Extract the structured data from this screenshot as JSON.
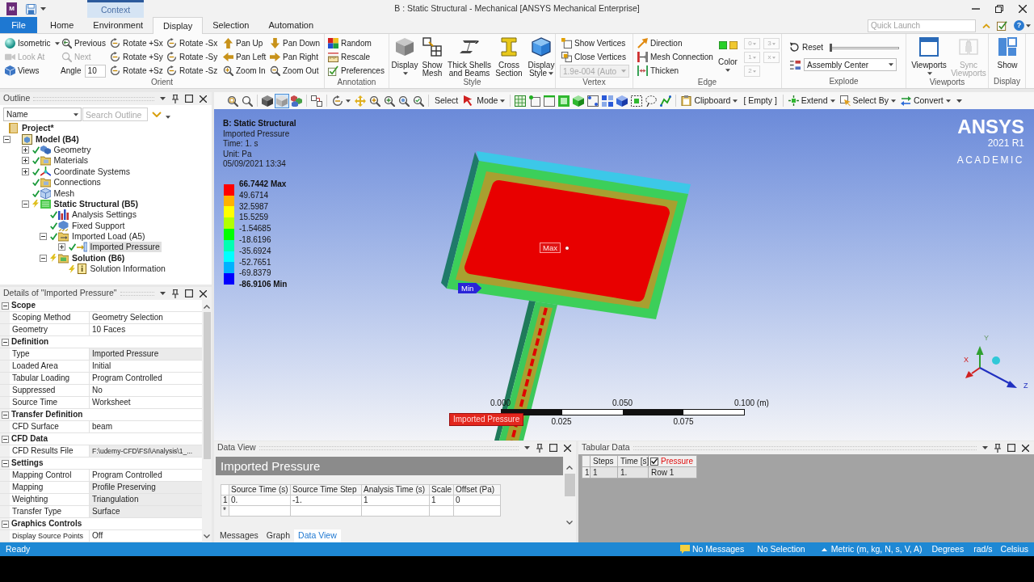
{
  "title_bar": {
    "app_logo": "M",
    "context_label": "Context",
    "title": "B : Static Structural - Mechanical [ANSYS Mechanical Enterprise]"
  },
  "ribbon_tabs": [
    {
      "label": "File",
      "kind": "file",
      "selected": false
    },
    {
      "label": "Home",
      "kind": "tab",
      "selected": false
    },
    {
      "label": "Environment",
      "kind": "tab",
      "selected": false
    },
    {
      "label": "Display",
      "kind": "tab",
      "selected": true
    },
    {
      "label": "Selection",
      "kind": "tab",
      "selected": false
    },
    {
      "label": "Automation",
      "kind": "tab",
      "selected": false
    }
  ],
  "quick_launch": {
    "placeholder": "Quick Launch",
    "help": "?"
  },
  "ribbon": {
    "orient": {
      "label": "Orient",
      "columns": [
        [
          {
            "kind": "split",
            "label": "Isometric",
            "disabled": false
          },
          {
            "kind": "button",
            "label": "Look At",
            "disabled": true
          },
          {
            "kind": "button",
            "label": "Views",
            "disabled": false
          }
        ],
        [
          {
            "kind": "button",
            "label": "Previous",
            "disabled": false
          },
          {
            "kind": "button",
            "label": "Next",
            "disabled": true
          },
          {
            "kind": "field",
            "label": "Angle",
            "value": "10"
          }
        ],
        [
          {
            "kind": "button",
            "label": "Rotate +Sx",
            "disabled": false
          },
          {
            "kind": "button",
            "label": "Rotate +Sy",
            "disabled": false
          },
          {
            "kind": "button",
            "label": "Rotate +Sz",
            "disabled": false
          }
        ],
        [
          {
            "kind": "button",
            "label": "Rotate -Sx",
            "disabled": false
          },
          {
            "kind": "button",
            "label": "Rotate -Sy",
            "disabled": false
          },
          {
            "kind": "button",
            "label": "Rotate -Sz",
            "disabled": false
          }
        ],
        [
          {
            "kind": "button",
            "label": "Pan Up",
            "disabled": false
          },
          {
            "kind": "button",
            "label": "Pan Left",
            "disabled": false
          },
          {
            "kind": "button",
            "label": "Zoom In",
            "disabled": false
          }
        ],
        [
          {
            "kind": "button",
            "label": "Pan Down",
            "disabled": false
          },
          {
            "kind": "button",
            "label": "Pan Right",
            "disabled": false
          },
          {
            "kind": "button",
            "label": "Zoom Out",
            "disabled": false
          }
        ]
      ]
    },
    "annotation": {
      "label": "Annotation",
      "buttons": [
        {
          "label": "Random"
        },
        {
          "label": "Rescale"
        },
        {
          "label": "Preferences"
        }
      ]
    },
    "style": {
      "label": "Style",
      "buttons": [
        {
          "label": "Display",
          "kind": "menu"
        },
        {
          "label": "Show Mesh",
          "kind": "button"
        },
        {
          "label": "Thick Shells and Beams",
          "kind": "button"
        },
        {
          "label": "Cross Section",
          "kind": "button"
        },
        {
          "label": "Display Style",
          "kind": "menu"
        }
      ]
    },
    "vertex": {
      "label": "Vertex",
      "buttons": [
        {
          "label": "Show Vertices"
        },
        {
          "label": "Close Vertices"
        }
      ],
      "size": {
        "value": "1.9e-004 (Auto",
        "disabled": true
      }
    },
    "edge": {
      "label": "Edge",
      "buttons": [
        {
          "label": "Direction"
        },
        {
          "label": "Mesh Connection"
        },
        {
          "label": "Thicken"
        }
      ],
      "color": {
        "label": "Color"
      },
      "options": [
        {
          "label": "0",
          "disabled": true
        },
        {
          "label": "1",
          "disabled": true
        },
        {
          "label": "2",
          "disabled": true
        },
        {
          "label": "3",
          "disabled": true
        },
        {
          "label": "x",
          "disabled": true
        }
      ]
    },
    "explode": {
      "label": "Explode",
      "reset": "Reset",
      "slider": {
        "level": 0
      },
      "center": {
        "value": "Assembly Center"
      }
    },
    "viewports": {
      "label": "Viewports",
      "buttons": [
        {
          "label": "Viewports",
          "kind": "menu",
          "disabled": false
        },
        {
          "label": "Sync Viewports",
          "kind": "button",
          "disabled": true
        }
      ]
    },
    "display": {
      "label": "Display",
      "buttons": [
        {
          "label": "Show"
        }
      ]
    }
  },
  "outline": {
    "title": "Outline",
    "filter": {
      "value": "Name"
    },
    "search": {
      "placeholder": "Search Outline"
    },
    "tree": [
      {
        "label": "Project*",
        "kind": "project",
        "bold": true,
        "selected": false,
        "children": [
          {
            "label": "Model (B4)",
            "kind": "model",
            "bold": true,
            "selected": false,
            "expanded": true,
            "children": [
              {
                "label": "Geometry",
                "kind": "geometry",
                "bold": false,
                "selected": false,
                "expanded": false,
                "up_to_date": true
              },
              {
                "label": "Materials",
                "kind": "materials",
                "bold": false,
                "selected": false,
                "expanded": false,
                "up_to_date": true
              },
              {
                "label": "Coordinate Systems",
                "kind": "coordinate_systems",
                "bold": false,
                "selected": false,
                "expanded": false,
                "up_to_date": true
              },
              {
                "label": "Connections",
                "kind": "connections",
                "bold": false,
                "selected": false,
                "up_to_date": true
              },
              {
                "label": "Mesh",
                "kind": "mesh",
                "bold": false,
                "selected": false,
                "up_to_date": true
              },
              {
                "label": "Static Structural (B5)",
                "kind": "analysis",
                "bold": true,
                "selected": false,
                "expanded": true,
                "up_to_date": false,
                "children": [
                  {
                    "label": "Analysis Settings",
                    "kind": "analysis_settings",
                    "bold": false,
                    "selected": false,
                    "up_to_date": true
                  },
                  {
                    "label": "Fixed Support",
                    "kind": "fixed_support",
                    "bold": false,
                    "selected": false,
                    "up_to_date": true
                  },
                  {
                    "label": "Imported Load (A5)",
                    "kind": "imported_load",
                    "bold": false,
                    "selected": false,
                    "expanded": true,
                    "up_to_date": true,
                    "children": [
                      {
                        "label": "Imported Pressure",
                        "kind": "imported_pressure",
                        "bold": false,
                        "selected": true,
                        "expanded": false,
                        "up_to_date": true
                      }
                    ]
                  },
                  {
                    "label": "Solution (B6)",
                    "kind": "solution",
                    "bold": true,
                    "selected": false,
                    "expanded": true,
                    "up_to_date": false,
                    "children": [
                      {
                        "label": "Solution Information",
                        "kind": "solution_information",
                        "bold": false,
                        "selected": false,
                        "up_to_date": false
                      }
                    ]
                  }
                ]
              }
            ]
          }
        ]
      }
    ]
  },
  "details": {
    "title": "Details of \"Imported Pressure\"",
    "sections": [
      {
        "title": "Scope",
        "expanded": true,
        "rows": [
          {
            "label": "Scoping Method",
            "value": "Geometry Selection",
            "readonly": false
          },
          {
            "label": "Geometry",
            "value": "10 Faces",
            "readonly": false
          }
        ]
      },
      {
        "title": "Definition",
        "expanded": true,
        "rows": [
          {
            "label": "Type",
            "value": "Imported Pressure",
            "readonly": true
          },
          {
            "label": "Loaded Area",
            "value": "Initial",
            "readonly": false
          },
          {
            "label": "Tabular Loading",
            "value": "Program Controlled",
            "readonly": false
          },
          {
            "label": "Suppressed",
            "value": "No",
            "readonly": false
          },
          {
            "label": "Source Time",
            "value": "Worksheet",
            "readonly": false
          }
        ]
      },
      {
        "title": "Transfer Definition",
        "expanded": true,
        "rows": [
          {
            "label": "CFD Surface",
            "value": "beam",
            "readonly": false
          }
        ]
      },
      {
        "title": "CFD Data",
        "expanded": true,
        "rows": [
          {
            "label": "CFD Results File",
            "value": "F:\\udemy-CFD\\FSI\\Analysis\\1_...",
            "readonly": true
          }
        ]
      },
      {
        "title": "Settings",
        "expanded": true,
        "rows": [
          {
            "label": "Mapping Control",
            "value": "Program Controlled",
            "readonly": false
          },
          {
            "label": "Mapping",
            "value": "Profile Preserving",
            "readonly": true
          },
          {
            "label": "Weighting",
            "value": "Triangulation",
            "readonly": true
          },
          {
            "label": "Transfer Type",
            "value": "Surface",
            "readonly": true
          }
        ]
      },
      {
        "title": "Graphics Controls",
        "expanded": true,
        "rows": [
          {
            "label": "Display Source Points",
            "value": "Off",
            "readonly": false
          }
        ]
      }
    ]
  },
  "graphics_toolbar": [
    [
      {
        "kind": "icon",
        "selected": false
      },
      {
        "kind": "icon",
        "selected": false
      }
    ],
    [
      {
        "kind": "icon",
        "selected": false
      },
      {
        "kind": "icon",
        "selected": true
      },
      {
        "kind": "icon",
        "selected": false
      }
    ],
    [
      {
        "kind": "icon",
        "selected": false
      }
    ],
    [
      {
        "kind": "icon_menu",
        "selected": false
      },
      {
        "kind": "icon",
        "selected": false
      },
      {
        "kind": "icon",
        "selected": false
      },
      {
        "kind": "icon",
        "selected": false
      },
      {
        "kind": "icon",
        "selected": false
      },
      {
        "kind": "icon",
        "selected": false
      }
    ],
    [
      {
        "kind": "text",
        "label": "Select"
      },
      {
        "kind": "menu",
        "label": "Mode"
      }
    ],
    [
      {
        "kind": "icon",
        "selected": false
      },
      {
        "kind": "icon",
        "selected": false
      },
      {
        "kind": "icon",
        "selected": false
      },
      {
        "kind": "icon",
        "selected": false
      },
      {
        "kind": "icon",
        "selected": false
      },
      {
        "kind": "icon",
        "selected": false
      },
      {
        "kind": "icon",
        "selected": false
      },
      {
        "kind": "icon",
        "selected": false
      },
      {
        "kind": "icon",
        "selected": false
      },
      {
        "kind": "icon",
        "selected": false
      },
      {
        "kind": "icon",
        "selected": false
      }
    ],
    [
      {
        "kind": "menu",
        "label": "Clipboard"
      },
      {
        "kind": "label",
        "label": "[ Empty ]"
      }
    ],
    [
      {
        "kind": "menu",
        "label": "Extend"
      },
      {
        "kind": "menu",
        "label": "Select By"
      },
      {
        "kind": "menu",
        "label": "Convert"
      },
      {
        "kind": "overflow"
      }
    ]
  ],
  "viewport": {
    "title": "B: Static Structural",
    "lines": [
      "Imported Pressure",
      "Time: 1. s",
      "Unit: Pa",
      "05/09/2021 13:34"
    ],
    "legend": {
      "max": "66.7442 Max",
      "levels": [
        "49.6714",
        "32.5987",
        "15.5259",
        "-1.54685",
        "-18.6196",
        "-35.6924",
        "-52.7651",
        "-69.8379"
      ],
      "min": "-86.9106 Min",
      "bands": [
        {
          "color": "#ff0000"
        },
        {
          "color": "#ffb200"
        },
        {
          "color": "#ffff00"
        },
        {
          "color": "#b2ff00"
        },
        {
          "color": "#00ff00"
        },
        {
          "color": "#00ffb2"
        },
        {
          "color": "#00ffff"
        },
        {
          "color": "#00b2ff"
        },
        {
          "color": "#0000ff"
        }
      ]
    },
    "logo": {
      "name": "ANSYS",
      "release": "2021 R1",
      "edition": "ACADEMIC"
    },
    "probes": [
      {
        "kind": "max",
        "label": "Max"
      },
      {
        "kind": "min",
        "label": "Min"
      }
    ],
    "load_tag": "Imported Pressure",
    "scale_bar": {
      "top_labels": [
        "0.000",
        "0.050",
        "0.100 (m)"
      ],
      "bottom_labels": [
        "0.025",
        "0.075"
      ]
    },
    "triad": {
      "x": "X",
      "y": "Y",
      "z": "Z"
    }
  },
  "data_view": {
    "title": "Data View",
    "heading": "Imported Pressure",
    "columns": [
      "Source Time (s)",
      "Source Time Step",
      "Analysis Time (s)",
      "Scale",
      "Offset (Pa)"
    ],
    "rows": [
      {
        "header": "1",
        "cells": [
          "0.",
          "-1.",
          "1",
          "1",
          "0"
        ]
      }
    ],
    "new_row": "*",
    "tabs": [
      {
        "label": "Messages",
        "selected": false
      },
      {
        "label": "Graph",
        "selected": false
      },
      {
        "label": "Data View",
        "selected": true
      }
    ]
  },
  "tabular_data": {
    "title": "Tabular Data",
    "columns": [
      {
        "label": "Steps",
        "kind": "plain"
      },
      {
        "label": "Time [s]",
        "kind": "plain"
      },
      {
        "label": "Pressure",
        "kind": "series",
        "checked": true
      }
    ],
    "rows": [
      {
        "header": "1",
        "cells": [
          "1",
          "1.",
          "Row 1"
        ]
      }
    ]
  },
  "status_bar": {
    "text": "Ready",
    "messages": "No Messages",
    "selection": "No Selection",
    "units": "Metric (m, kg, N, s, V, A)",
    "angle": "Degrees",
    "angular_velocity": "rad/s",
    "temperature": "Celsius"
  }
}
